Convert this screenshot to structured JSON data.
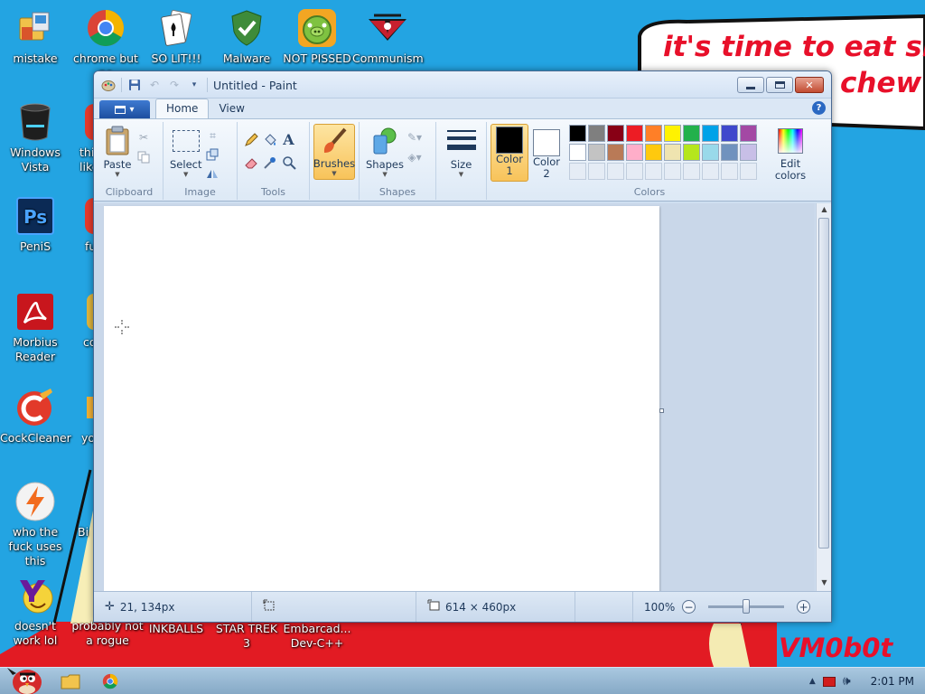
{
  "desktop": {
    "wallpaper_texts": [
      "it's time to eat shit",
      "chew",
      "VM0b0t"
    ],
    "icons": [
      {
        "id": "mistake",
        "label": "mistake",
        "icon": "folder-pc-icon"
      },
      {
        "id": "chrome",
        "label": "chrome but no",
        "icon": "chrome-icon"
      },
      {
        "id": "solit",
        "label": "SO LIT!!!",
        "icon": "solitaire-icon"
      },
      {
        "id": "malware",
        "label": "Malware",
        "icon": "shield-check-icon"
      },
      {
        "id": "notpissed",
        "label": "NOT PISSED",
        "icon": "angry-pig-icon"
      },
      {
        "id": "communism",
        "label": "Communism",
        "icon": "emblem-icon"
      },
      {
        "id": "vista",
        "label": "Windows Vista",
        "icon": "trash-bin-icon"
      },
      {
        "id": "thi",
        "label": "thi like",
        "icon": "partial-icon"
      },
      {
        "id": "penis",
        "label": "PeniS",
        "icon": "photoshop-icon"
      },
      {
        "id": "fu",
        "label": "fu",
        "icon": "partial-icon"
      },
      {
        "id": "morbius",
        "label": "Morbius Reader",
        "icon": "pdf-reader-icon"
      },
      {
        "id": "co",
        "label": "co",
        "icon": "partial-icon"
      },
      {
        "id": "cockcleaner",
        "label": "CockCleaner",
        "icon": "cleaner-icon"
      },
      {
        "id": "yo",
        "label": "yo",
        "icon": "partial-icon"
      },
      {
        "id": "whothefuck",
        "label": "who the fuck uses this",
        "icon": "lightning-icon"
      },
      {
        "id": "bi",
        "label": "Bi",
        "icon": "partial-icon"
      },
      {
        "id": "doesnt",
        "label": "doesn't work lol",
        "icon": "yahoo-icon"
      },
      {
        "id": "probably",
        "label": "probably not a rogue",
        "icon": "shield-icon"
      },
      {
        "id": "inkballs",
        "label": "INKBALLS",
        "icon": "blank-icon"
      },
      {
        "id": "startrek",
        "label": "STAR TREK 3",
        "icon": "blank-icon"
      },
      {
        "id": "embarcadero",
        "label": "Embarcad... Dev-C++",
        "icon": "blank-icon"
      }
    ]
  },
  "paint": {
    "title": "Untitled - Paint",
    "tabs": [
      "Home",
      "View"
    ],
    "active_tab": "Home",
    "groups": {
      "clipboard": {
        "label": "Clipboard",
        "paste": "Paste"
      },
      "image": {
        "label": "Image",
        "select": "Select"
      },
      "tools": {
        "label": "Tools"
      },
      "brushes": {
        "label": "Brushes"
      },
      "shapes": {
        "label": "Shapes",
        "button": "Shapes"
      },
      "size": {
        "label": "Size"
      },
      "colors": {
        "label": "Colors",
        "color1": "Color 1",
        "color2": "Color 2",
        "edit": "Edit colors"
      }
    },
    "color1_value": "#000000",
    "color2_value": "#ffffff",
    "palette_row1": [
      "#000000",
      "#7f7f7f",
      "#880015",
      "#ed1c24",
      "#ff7f27",
      "#fff200",
      "#22b14c",
      "#00a2e8",
      "#3f48cc",
      "#a349a4"
    ],
    "palette_row2": [
      "#ffffff",
      "#c3c3c3",
      "#b97a57",
      "#ffaec9",
      "#ffc90e",
      "#efe4b0",
      "#b5e61d",
      "#99d9ea",
      "#7092be",
      "#c8bfe7"
    ],
    "status": {
      "cursor_pos": "21, 134px",
      "selection_size": "",
      "image_size": "614 × 460px",
      "zoom": "100%"
    }
  },
  "taskbar": {
    "clock": "2:01 PM"
  }
}
